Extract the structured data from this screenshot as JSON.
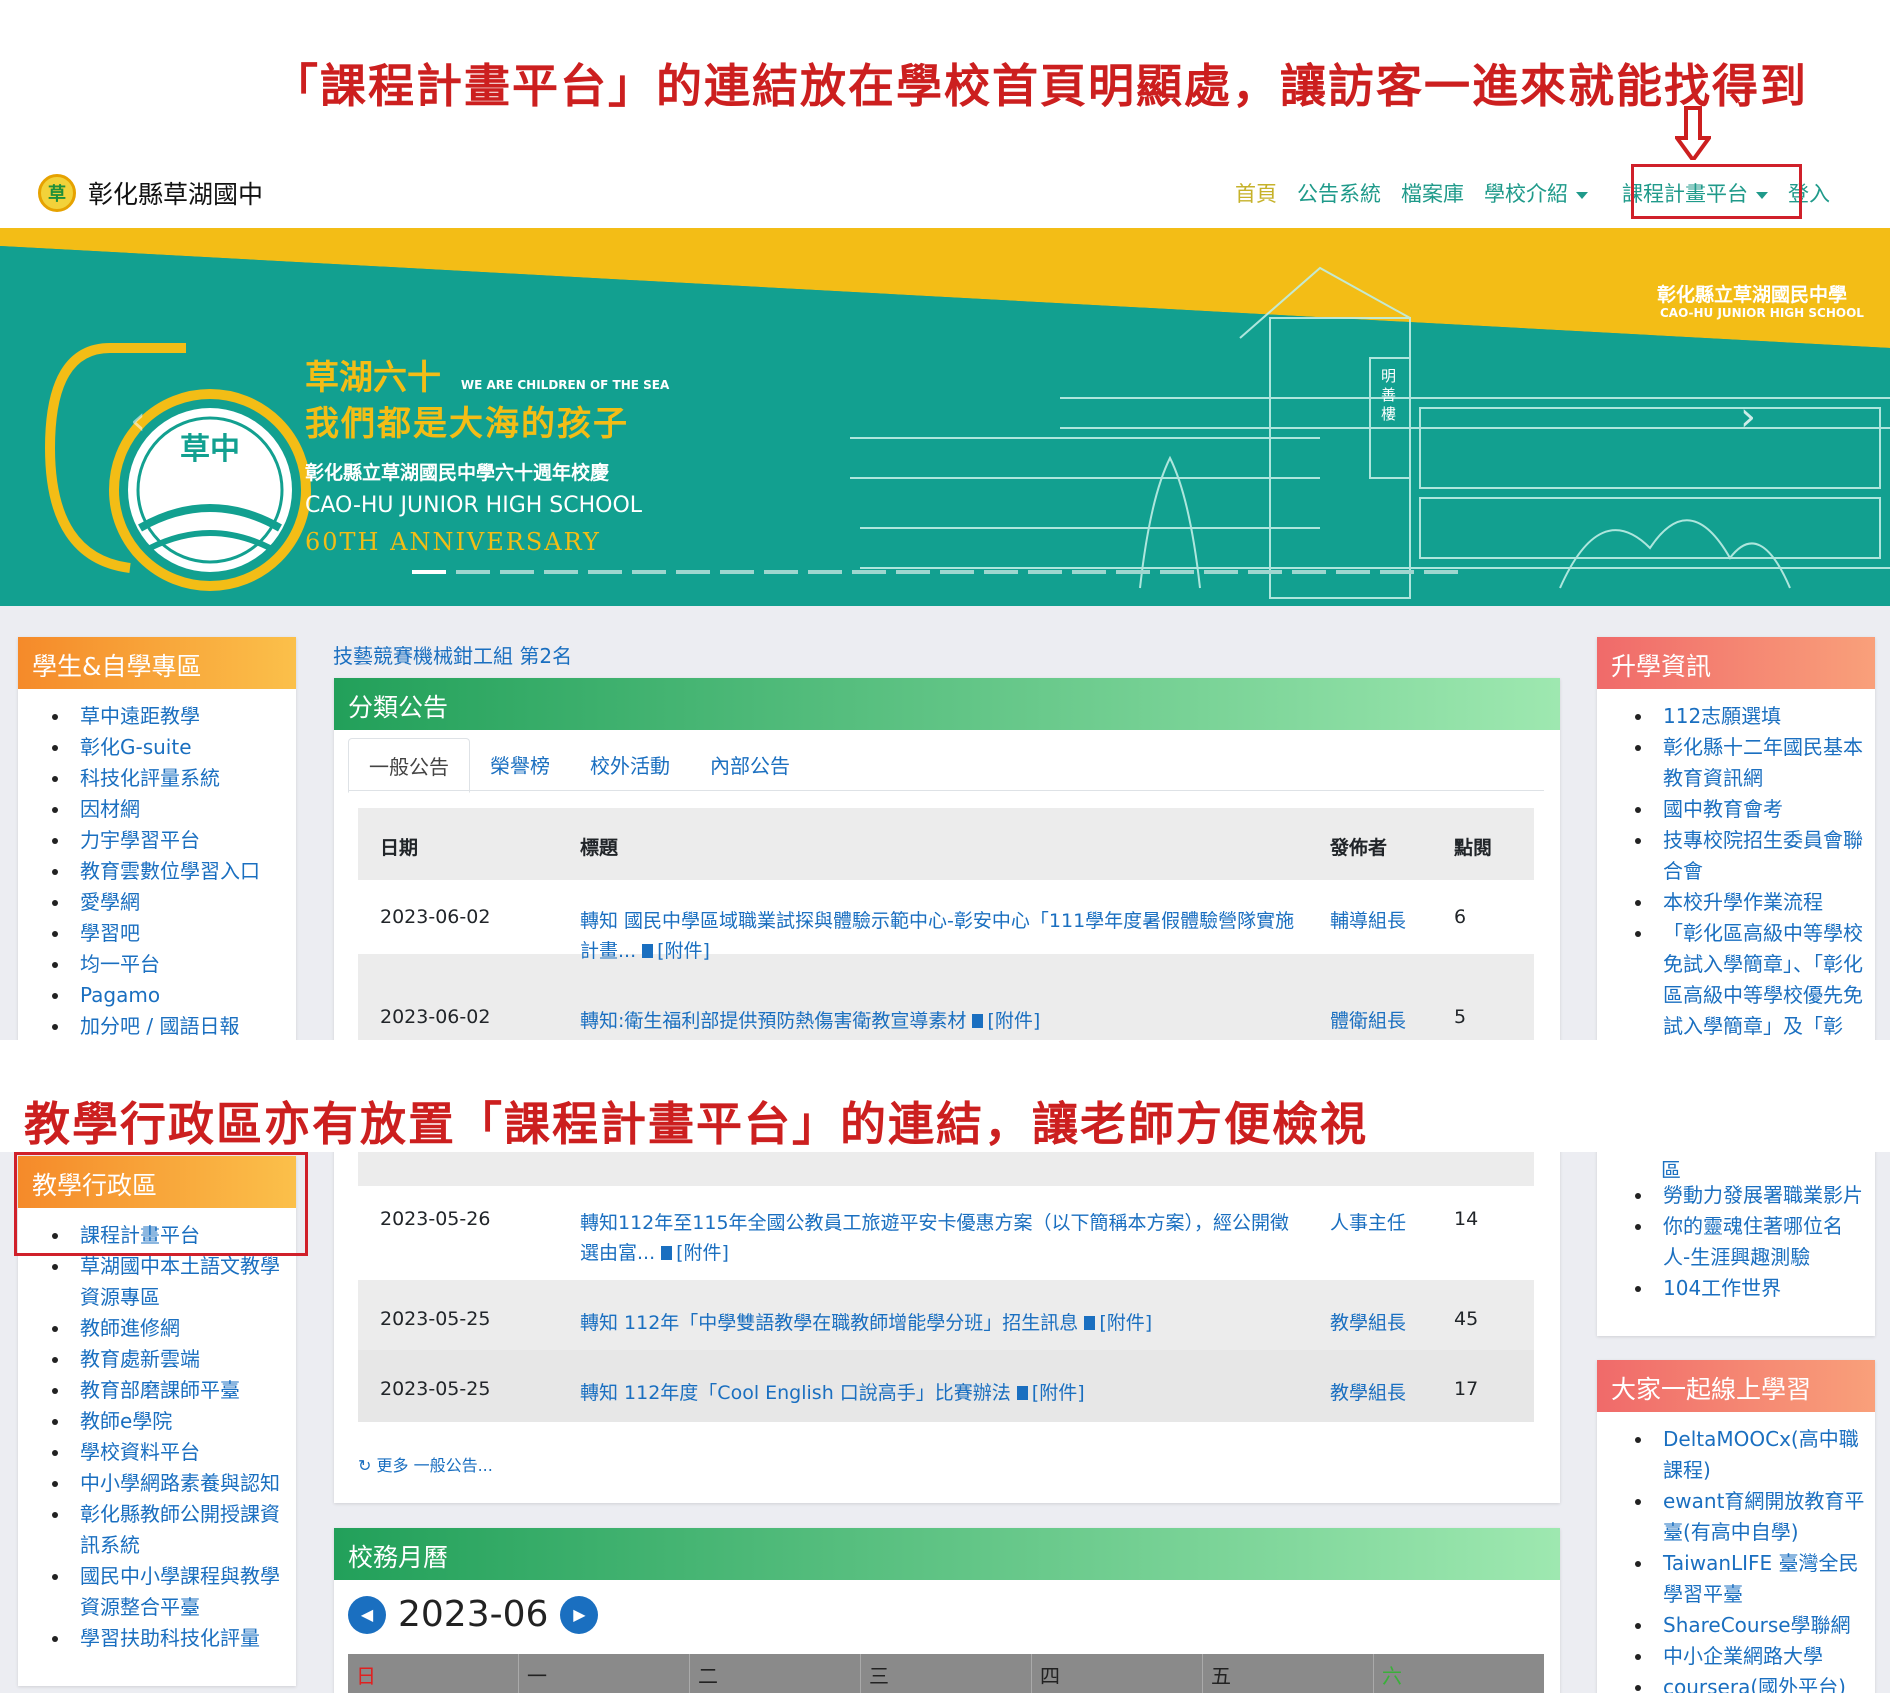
{
  "annotations": {
    "top": "「課程計畫平台」的連結放在學校首頁明顯處，讓訪客一進來就能找得到",
    "bottom": "教學行政區亦有放置「課程計畫平台」的連結，讓老師方便檢視"
  },
  "site": {
    "logo_text": "草",
    "name": "彰化縣草湖國中"
  },
  "nav": {
    "home": "首頁",
    "announce": "公告系統",
    "files": "檔案庫",
    "intro": "學校介紹",
    "curriculum": "課程計畫平台",
    "login": "登入"
  },
  "banner": {
    "school_cn": "彰化縣立草湖國民中學",
    "school_en": "CAO-HU JUNIOR HIGH SCHOOL",
    "headline1": "草湖六十",
    "headline_en": "WE ARE CHILDREN OF THE SEA",
    "headline2": "我們都是大海的孩子",
    "sub_cn": "彰化縣立草湖國民中學六十週年校慶",
    "sub_en1": "CAO-HU JUNIOR HIGH SCHOOL",
    "sub_en2": "60TH ANNIVERSARY",
    "big_number": "60",
    "emblem": "草中",
    "building_sign": "明善樓"
  },
  "left_panel": {
    "title": "學生&自學專區",
    "items": [
      "草中遠距教學",
      "彰化G-suite",
      "科技化評量系統",
      "因材網",
      "力宇學習平台",
      "教育雲數位學習入口",
      "愛學網",
      "學習吧",
      "均一平台",
      "Pagamo",
      "加分吧 / 國語日報"
    ]
  },
  "right_panel": {
    "title": "升學資訊",
    "items": [
      "112志願選填",
      "彰化縣十二年國民基本教育資訊網",
      "國中教育會考",
      "技專校院招生委員會聯合會",
      "本校升學作業流程",
      "「彰化區高級中等學校免試入學簡章」、「彰化區高級中等學校優先免試入學簡章」及「彰"
    ]
  },
  "ticker": "技藝競賽機械鉗工組 第2名",
  "announcements": {
    "title": "分類公告",
    "tabs": [
      "一般公告",
      "榮譽榜",
      "校外活動",
      "內部公告"
    ],
    "headers": [
      "日期",
      "標題",
      "發佈者",
      "點閱"
    ],
    "rows_top": [
      {
        "date": "2023-06-02",
        "title": "轉知 國民中學區域職業試探與體驗示範中心-彰安中心「111學年度暑假體驗營隊實施計畫...",
        "attach": "[附件]",
        "author": "輔導組長",
        "hits": "6"
      },
      {
        "date": "2023-06-02",
        "title": "轉知:衛生福利部提供預防熱傷害衛教宣導素材",
        "attach": "[附件]",
        "author": "體衛組長",
        "hits": "5"
      }
    ],
    "rows_bottom": [
      {
        "date": "2023-05-26",
        "title": "轉知112年至115年全國公教員工旅遊平安卡優惠方案（以下簡稱本方案），經公開徵選由富...",
        "attach": "[附件]",
        "author": "人事主任",
        "hits": "14"
      },
      {
        "date": "2023-05-25",
        "title": "轉知 112年「中學雙語教學在職教師增能學分班」招生訊息",
        "attach": "[附件]",
        "author": "教學組長",
        "hits": "45"
      },
      {
        "date": "2023-05-25",
        "title": "轉知 112年度「Cool English 口說高手」比賽辦法",
        "attach": "[附件]",
        "author": "教學組長",
        "hits": "17"
      }
    ],
    "more": "更多 一般公告..."
  },
  "teaching_panel": {
    "title": "教學行政區",
    "items": [
      "課程計畫平台",
      "草湖國中本土語文教學資源專區",
      "教師進修網",
      "教育處新雲端",
      "教育部磨課師平臺",
      "教師e學院",
      "學校資料平台",
      "中小學網路素養與認知",
      "彰化縣教師公開授課資訊系統",
      "國民中小學課程與教學資源整合平臺",
      "學習扶助科技化評量"
    ]
  },
  "right_bottom": {
    "fragment": "區",
    "items": [
      "勞動力發展署職業影片",
      "你的靈魂住著哪位名人-生涯興趣測驗",
      "104工作世界"
    ]
  },
  "online_panel": {
    "title": "大家一起線上學習",
    "items": [
      "DeltaMOOCx(高中職課程)",
      "ewant育網開放教育平臺(有高中自學)",
      "TaiwanLIFE 臺灣全民學習平臺",
      "ShareCourse學聯網",
      "中小企業網路大學",
      "coursera(國外平台)"
    ]
  },
  "calendar": {
    "title": "校務月曆",
    "month": "2023-06",
    "prev": "◀",
    "next": "▶",
    "days": [
      "日",
      "一",
      "二",
      "三",
      "四",
      "五",
      "六"
    ]
  },
  "colors": {
    "accent": "#1a6fc0",
    "annotation": "#cc1f1f",
    "teal": "#12a090",
    "yellow": "#f3bd16"
  }
}
